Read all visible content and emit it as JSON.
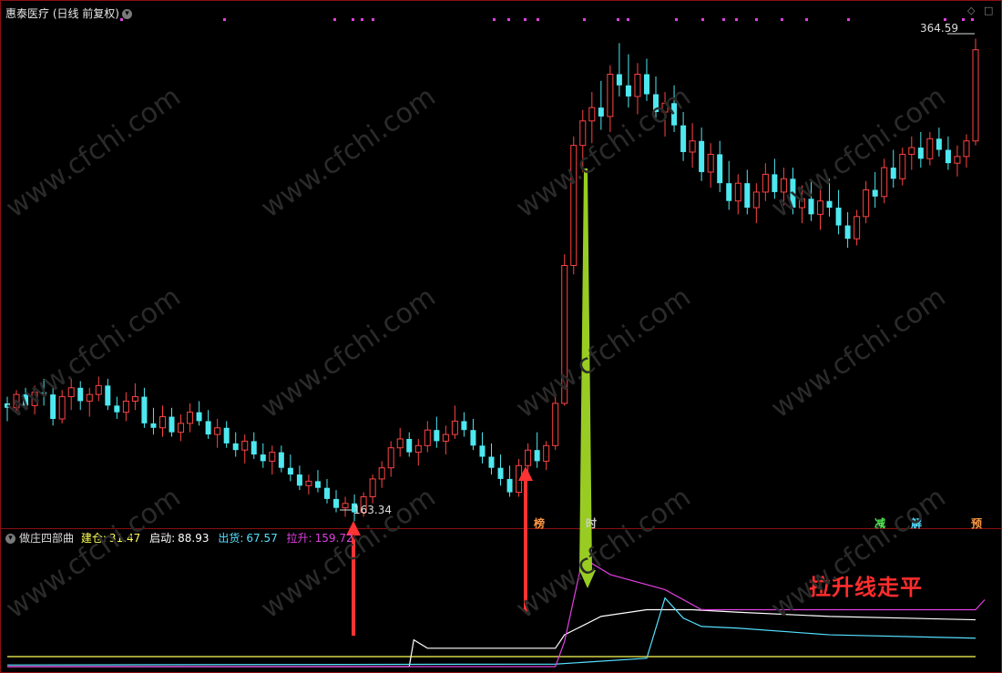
{
  "header": {
    "title": "惠泰医疗 (日线 前复权)"
  },
  "indicator": {
    "name": "做庄四部曲",
    "lines": [
      {
        "label": "建仓:",
        "value": "31.47",
        "color": "#ffff55"
      },
      {
        "label": "启动:",
        "value": "88.93",
        "color": "#ffffff"
      },
      {
        "label": "出货:",
        "value": "67.57",
        "color": "#55e0ff"
      },
      {
        "label": "拉升:",
        "value": "159.72",
        "color": "#e040e0"
      }
    ]
  },
  "price_labels": {
    "high": "364.59",
    "low": "163.34"
  },
  "signals": [
    {
      "text": "榜",
      "color": "#ff9944"
    },
    {
      "text": "时",
      "color": "#cccccc"
    },
    {
      "text": "减",
      "color": "#55ee55"
    },
    {
      "text": "解",
      "color": "#55ddff"
    },
    {
      "text": "预",
      "color": "#ff9944"
    }
  ],
  "annotation": "拉升线走平",
  "watermark": "www.cfchi.com",
  "colors": {
    "up": "#ff4444",
    "down": "#4ee8f0",
    "divider": "#8a1010"
  },
  "chart_data": [
    {
      "type": "candlestick",
      "series": [
        {
          "ohlc": [
            [
              200,
              203,
              192,
              198
            ],
            [
              198,
              206,
              196,
              204
            ],
            [
              204,
              207,
              197,
              199
            ],
            [
              199,
              208,
              195,
              205
            ],
            [
              205,
              211,
              199,
              204
            ],
            [
              204,
              208,
              190,
              193
            ],
            [
              193,
              206,
              191,
              203
            ],
            [
              203,
              211,
              197,
              207
            ],
            [
              207,
              210,
              197,
              201
            ],
            [
              201,
              207,
              194,
              204
            ],
            [
              204,
              212,
              201,
              208
            ],
            [
              208,
              211,
              197,
              199
            ],
            [
              199,
              203,
              193,
              196
            ],
            [
              196,
              205,
              192,
              201
            ],
            [
              201,
              209,
              197,
              203
            ],
            [
              203,
              207,
              189,
              191
            ],
            [
              191,
              198,
              186,
              189
            ],
            [
              189,
              199,
              185,
              194
            ],
            [
              194,
              198,
              185,
              187
            ],
            [
              187,
              195,
              183,
              191
            ],
            [
              191,
              200,
              187,
              196
            ],
            [
              196,
              201,
              190,
              192
            ],
            [
              192,
              197,
              184,
              186
            ],
            [
              186,
              193,
              180,
              189
            ],
            [
              189,
              192,
              180,
              182
            ],
            [
              182,
              187,
              176,
              179
            ],
            [
              179,
              186,
              173,
              183
            ],
            [
              183,
              187,
              175,
              177
            ],
            [
              177,
              182,
              171,
              174
            ],
            [
              174,
              181,
              168,
              178
            ],
            [
              178,
              181,
              169,
              171
            ],
            [
              171,
              177,
              165,
              168
            ],
            [
              168,
              172,
              161,
              163
            ],
            [
              163,
              168,
              159,
              165
            ],
            [
              165,
              170,
              160,
              162
            ],
            [
              162,
              166,
              155,
              157
            ],
            [
              157,
              161,
              151,
              153
            ],
            [
              153,
              158,
              149,
              155
            ],
            [
              155,
              159,
              147,
              151
            ],
            [
              151,
              160,
              149,
              158
            ],
            [
              158,
              168,
              155,
              166
            ],
            [
              166,
              174,
              162,
              171
            ],
            [
              171,
              183,
              167,
              180
            ],
            [
              180,
              189,
              176,
              184
            ],
            [
              184,
              187,
              176,
              178
            ],
            [
              178,
              184,
              172,
              181
            ],
            [
              181,
              192,
              178,
              188
            ],
            [
              188,
              194,
              180,
              183
            ],
            [
              183,
              190,
              177,
              186
            ],
            [
              186,
              199,
              184,
              192
            ],
            [
              192,
              196,
              185,
              188
            ],
            [
              188,
              193,
              179,
              181
            ],
            [
              181,
              187,
              173,
              176
            ],
            [
              176,
              182,
              168,
              171
            ],
            [
              171,
              177,
              163,
              166
            ],
            [
              166,
              172,
              158,
              160
            ],
            [
              160,
              175,
              158,
              172
            ],
            [
              172,
              182,
              169,
              179
            ],
            [
              179,
              187,
              171,
              174
            ],
            [
              174,
              183,
              170,
              181
            ],
            [
              181,
              204,
              179,
              200
            ],
            [
              200,
              267,
              199,
              262
            ],
            [
              262,
              320,
              258,
              316
            ],
            [
              316,
              332,
              304,
              327
            ],
            [
              327,
              340,
              317,
              333
            ],
            [
              333,
              345,
              323,
              329
            ],
            [
              329,
              352,
              322,
              348
            ],
            [
              348,
              362,
              338,
              343
            ],
            [
              343,
              357,
              333,
              338
            ],
            [
              338,
              353,
              330,
              348
            ],
            [
              348,
              355,
              336,
              339
            ],
            [
              339,
              347,
              327,
              331
            ],
            [
              331,
              340,
              320,
              335
            ],
            [
              335,
              343,
              322,
              325
            ],
            [
              325,
              331,
              309,
              313
            ],
            [
              313,
              326,
              306,
              318
            ],
            [
              318,
              324,
              300,
              304
            ],
            [
              304,
              317,
              297,
              312
            ],
            [
              312,
              318,
              295,
              299
            ],
            [
              299,
              309,
              287,
              291
            ],
            [
              291,
              303,
              285,
              299
            ],
            [
              299,
              305,
              285,
              288
            ],
            [
              288,
              299,
              281,
              295
            ],
            [
              295,
              308,
              291,
              303
            ],
            [
              303,
              310,
              292,
              295
            ],
            [
              295,
              306,
              289,
              301
            ],
            [
              301,
              306,
              285,
              288
            ],
            [
              288,
              298,
              281,
              292
            ],
            [
              292,
              300,
              282,
              285
            ],
            [
              285,
              296,
              278,
              291
            ],
            [
              291,
              301,
              284,
              288
            ],
            [
              288,
              296,
              276,
              280
            ],
            [
              280,
              286,
              270,
              274
            ],
            [
              274,
              287,
              271,
              284
            ],
            [
              284,
              300,
              281,
              296
            ],
            [
              296,
              304,
              288,
              293
            ],
            [
              293,
              310,
              290,
              306
            ],
            [
              306,
              314,
              297,
              301
            ],
            [
              301,
              315,
              298,
              312
            ],
            [
              312,
              320,
              305,
              315
            ],
            [
              315,
              322,
              306,
              310
            ],
            [
              310,
              322,
              307,
              319
            ],
            [
              319,
              324,
              311,
              314
            ],
            [
              314,
              320,
              305,
              308
            ],
            [
              308,
              316,
              302,
              311
            ],
            [
              311,
              321,
              306,
              318
            ],
            [
              318,
              364,
              316,
              359
            ]
          ]
        }
      ],
      "markers": {
        "high": 364.59,
        "low": 163.34
      }
    },
    {
      "type": "line",
      "x_count": 107,
      "series": [
        {
          "name": "建仓",
          "values": [
            [
              0,
              12
            ],
            [
              60,
              12
            ],
            [
              106,
              12
            ]
          ]
        },
        {
          "name": "启动",
          "values": [
            [
              0,
              0
            ],
            [
              44,
              0
            ],
            [
              44.5,
              32
            ],
            [
              46,
              22
            ],
            [
              60,
              22
            ],
            [
              61,
              38
            ],
            [
              65,
              60
            ],
            [
              70,
              68
            ],
            [
              75,
              68
            ],
            [
              80,
              65
            ],
            [
              90,
              60
            ],
            [
              106,
              56
            ]
          ]
        },
        {
          "name": "出货",
          "values": [
            [
              0,
              2
            ],
            [
              60,
              3
            ],
            [
              70,
              10
            ],
            [
              72,
              82
            ],
            [
              74,
              58
            ],
            [
              76,
              48
            ],
            [
              80,
              46
            ],
            [
              90,
              38
            ],
            [
              106,
              34
            ]
          ]
        },
        {
          "name": "拉升",
          "values": [
            [
              0,
              0
            ],
            [
              60,
              0
            ],
            [
              61,
              30
            ],
            [
              63,
              130
            ],
            [
              66,
              110
            ],
            [
              72,
              92
            ],
            [
              76,
              68
            ],
            [
              106,
              68
            ],
            [
              107,
              80
            ]
          ]
        }
      ]
    }
  ]
}
